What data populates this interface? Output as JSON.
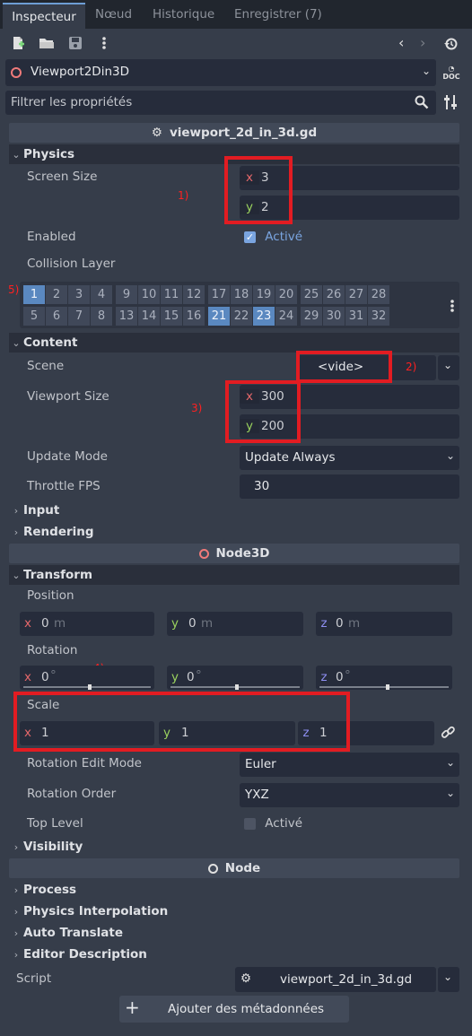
{
  "tabs": [
    "Inspecteur",
    "Nœud",
    "Historique",
    "Enregistrer (7)"
  ],
  "node_selector": {
    "name": "Viewport2Din3D"
  },
  "filter": {
    "placeholder": "Filtrer les propriétés"
  },
  "script_header": "viewport_2d_in_3d.gd",
  "physics": {
    "title": "Physics",
    "screen_size_label": "Screen Size",
    "x": "3",
    "y": "2",
    "enabled_label": "Enabled",
    "enabled_value": "Activé",
    "collision_layer_label": "Collision Layer",
    "layers_row1": [
      "1",
      "2",
      "3",
      "4",
      "9",
      "10",
      "11",
      "12",
      "17",
      "18",
      "19",
      "20",
      "25",
      "26",
      "27",
      "28"
    ],
    "layers_row2": [
      "5",
      "6",
      "7",
      "8",
      "13",
      "14",
      "15",
      "16",
      "21",
      "22",
      "23",
      "24",
      "29",
      "30",
      "31",
      "32"
    ],
    "active_layers": [
      "1",
      "21",
      "23"
    ]
  },
  "content": {
    "title": "Content",
    "scene_label": "Scene",
    "scene_value": "<vide>",
    "viewport_size_label": "Viewport Size",
    "x": "300",
    "y": "200",
    "update_mode_label": "Update Mode",
    "update_mode_value": "Update Always",
    "throttle_label": "Throttle FPS",
    "throttle_value": "30"
  },
  "groups": {
    "input": "Input",
    "rendering": "Rendering"
  },
  "node3d_header": "Node3D",
  "transform": {
    "title": "Transform",
    "position_label": "Position",
    "px": "0",
    "py": "0",
    "pz": "0",
    "unit_m": "m",
    "rotation_label": "Rotation",
    "rx": "0",
    "ry": "0",
    "rz": "0",
    "deg": "°",
    "scale_label": "Scale",
    "sx": "1",
    "sy": "1",
    "sz": "1",
    "rem_label": "Rotation Edit Mode",
    "rem_value": "Euler",
    "ro_label": "Rotation Order",
    "ro_value": "YXZ",
    "toplevel_label": "Top Level",
    "toplevel_value": "Activé"
  },
  "visibility": "Visibility",
  "node_header": "Node",
  "node_groups": [
    "Process",
    "Physics Interpolation",
    "Auto Translate",
    "Editor Description"
  ],
  "script_row": {
    "label": "Script",
    "value": "viewport_2d_in_3d.gd"
  },
  "add_metadata": "Ajouter des métadonnées",
  "axis": {
    "x": "x",
    "y": "y",
    "z": "z"
  },
  "annotations": {
    "a1": "1)",
    "a2": "2)",
    "a3": "3)",
    "a4": "4)",
    "a5": "5)"
  },
  "colors": {
    "accent": "#5a88c0",
    "highlight": "#e21c22",
    "x_axis": "#e3676a",
    "y_axis": "#9ad25e",
    "z_axis": "#8d8ef0"
  }
}
